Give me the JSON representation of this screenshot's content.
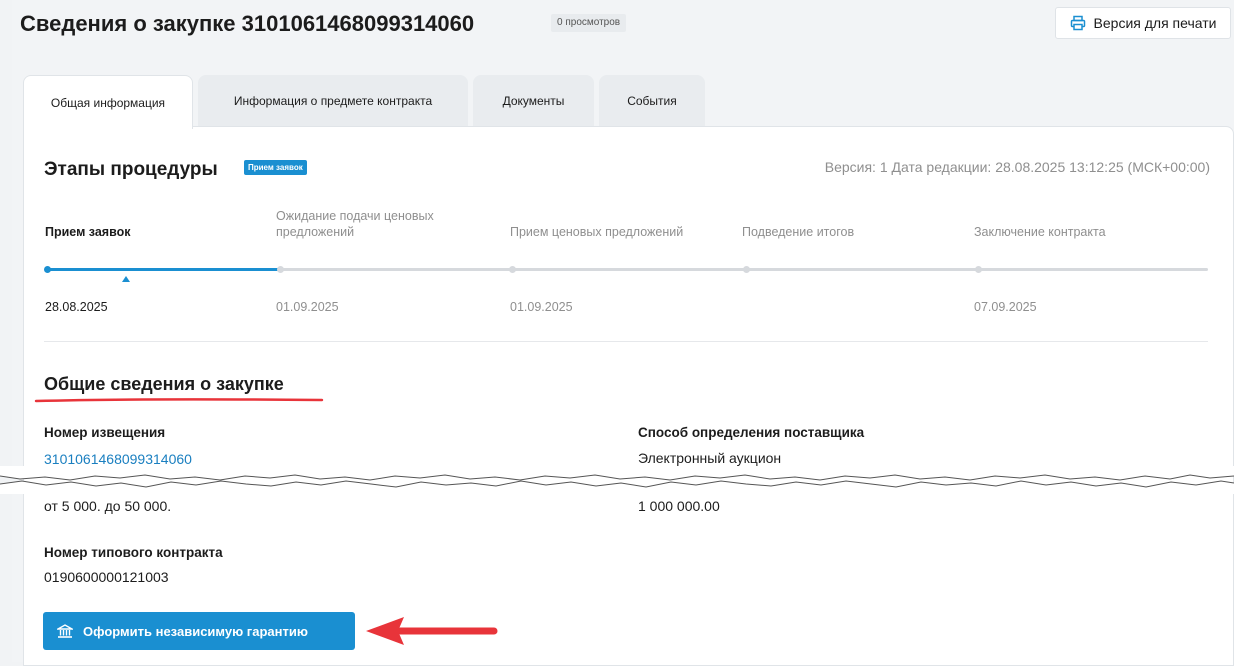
{
  "header": {
    "title": "Сведения о закупке 3101061468099314060",
    "views": "0 просмотров",
    "print_label": "Версия для печати"
  },
  "tabs": [
    {
      "label": "Общая информация",
      "active": true
    },
    {
      "label": "Информация о предмете контракта",
      "active": false
    },
    {
      "label": "Документы",
      "active": false
    },
    {
      "label": "События",
      "active": false
    }
  ],
  "procedure": {
    "title": "Этапы процедуры",
    "current_badge": "Прием заявок",
    "version": "Версия: 1 Дата редакции: 28.08.2025 13:12:25 (МСК+00:00)",
    "stages": [
      {
        "name": "Прием заявок",
        "date": "28.08.2025"
      },
      {
        "name": "Ожидание подачи ценовых предложений",
        "date": "01.09.2025"
      },
      {
        "name": "Прием ценовых предложений",
        "date": "01.09.2025"
      },
      {
        "name": "Подведение итогов",
        "date": ""
      },
      {
        "name": "Заключение контракта",
        "date": "07.09.2025"
      }
    ]
  },
  "general": {
    "title": "Общие сведения о закупке",
    "notice_label": "Номер извещения",
    "notice_value": "3101061468099314060",
    "method_label": "Способ определения поставщика",
    "method_value": "Электронный аукцион",
    "range_value": "от 5 000. до 50 000.",
    "amount_value": "1 000 000.00",
    "contract_label": "Номер типового контракта",
    "contract_value": "0190600000121003"
  },
  "actions": {
    "guarantee_label": "Оформить независимую гарантию"
  },
  "colors": {
    "accent": "#1a8fd1",
    "annotation": "#e8343a",
    "muted_text": "#8f8f8f"
  }
}
